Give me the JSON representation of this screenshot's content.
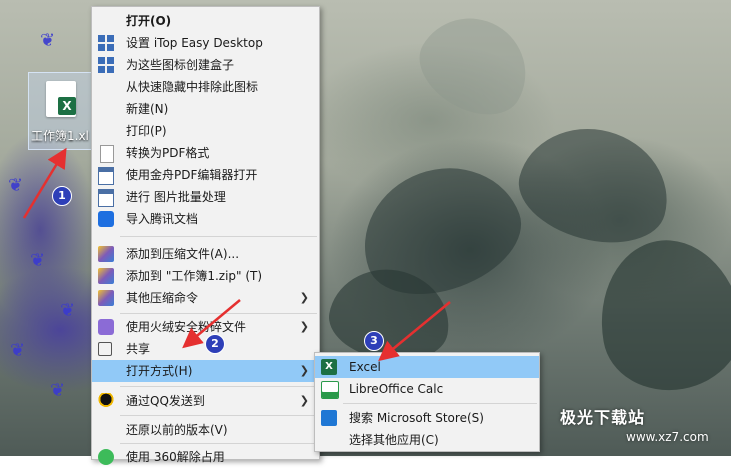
{
  "desktop_file": {
    "name": "工作簿1.xl",
    "icon": "excel-file-icon"
  },
  "context_menu": {
    "items": [
      {
        "label": "打开(O)",
        "icon": "none",
        "bold": true
      },
      {
        "label": "设置 iTop Easy Desktop",
        "icon": "itop-tiles-icon"
      },
      {
        "label": "为这些图标创建盒子",
        "icon": "itop-tiles-icon"
      },
      {
        "label": "从快速隐藏中排除此图标",
        "icon": "none"
      },
      {
        "label": "新建(N)",
        "icon": "none"
      },
      {
        "label": "打印(P)",
        "icon": "none"
      },
      {
        "label": "转换为PDF格式",
        "icon": "document-icon"
      },
      {
        "label": "使用金舟PDF编辑器打开",
        "icon": "pdf-editor-icon"
      },
      {
        "label": "进行 图片批量处理",
        "icon": "image-batch-icon"
      },
      {
        "label": "导入腾讯文档",
        "icon": "tencent-docs-icon"
      },
      {
        "label": "添加到压缩文件(A)...",
        "icon": "winrar-icon"
      },
      {
        "label": "添加到 \"工作簿1.zip\" (T)",
        "icon": "winrar-icon"
      },
      {
        "label": "其他压缩命令",
        "icon": "winrar-icon",
        "submenu": true
      },
      {
        "label": "使用火绒安全粉碎文件",
        "icon": "huorong-icon",
        "submenu": true
      },
      {
        "label": "共享",
        "icon": "share-icon"
      },
      {
        "label": "打开方式(H)",
        "icon": "none",
        "submenu": true,
        "highlighted": true
      },
      {
        "label": "通过QQ发送到",
        "icon": "qq-icon",
        "submenu": true
      },
      {
        "label": "还原以前的版本(V)",
        "icon": "none"
      },
      {
        "label": "使用 360解除占用",
        "icon": "360-icon"
      }
    ]
  },
  "open_with_submenu": {
    "items": [
      {
        "label": "Excel",
        "icon": "excel-icon",
        "highlighted": true
      },
      {
        "label": "LibreOffice Calc",
        "icon": "libreoffice-calc-icon"
      },
      {
        "label": "搜索 Microsoft Store(S)",
        "icon": "microsoft-store-icon"
      },
      {
        "label": "选择其他应用(C)",
        "icon": "none"
      }
    ]
  },
  "step_badges": [
    "1",
    "2",
    "3"
  ],
  "watermark": {
    "text": "极光下载站",
    "url": "www.xz7.com"
  },
  "colors": {
    "highlight": "#91c9f7",
    "menu_bg": "#f2f2f2",
    "arrow": "#e53030",
    "badge": "#2e3fb8"
  }
}
